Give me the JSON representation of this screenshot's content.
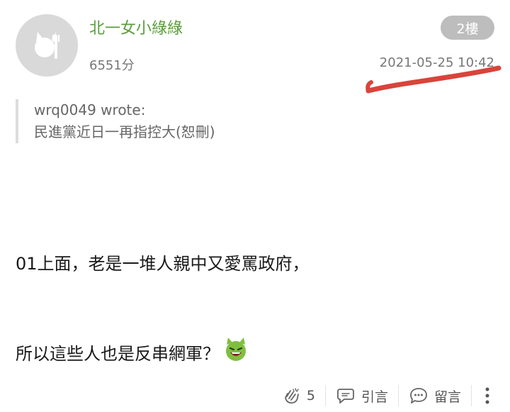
{
  "post": {
    "username": "北一女小綠綠",
    "score": "6551分",
    "floor": "2樓",
    "timestamp": "2021-05-25 10:42",
    "quote": {
      "author": "wrq0049 wrote:",
      "text": "民進黨近日一再指控大(恕刪)"
    },
    "body": [
      "01上面，老是一堆人親中又愛罵政府，",
      "所以這些人也是反串網軍？"
    ]
  },
  "actions": {
    "like_count": "5",
    "quote_label": "引言",
    "reply_label": "留言"
  },
  "colors": {
    "username": "#5a9d3c",
    "badge": "#bdbdbd",
    "annotation": "#d9443a"
  },
  "icons": [
    "avatar-cat-fork-icon",
    "clap-icon",
    "quote-bubble-icon",
    "comment-bubble-icon",
    "more-vertical-icon",
    "devil-emoji-icon"
  ]
}
